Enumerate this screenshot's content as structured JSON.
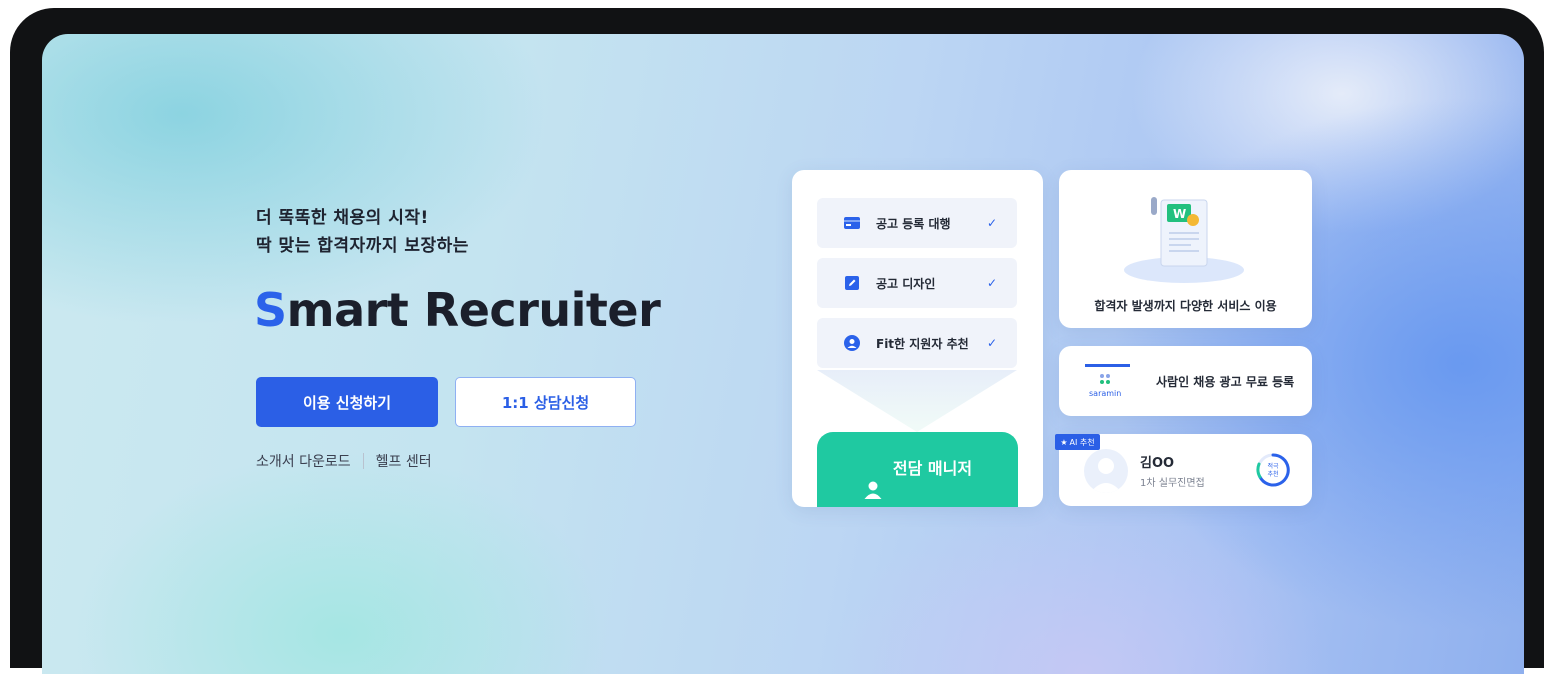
{
  "hero": {
    "tagline_line1": "더 똑똑한 채용의 시작!",
    "tagline_line2": "딱 맞는 합격자까지 보장하는",
    "brand_first_letter": "S",
    "brand_rest": "mart Recruiter",
    "primary_button": "이용 신청하기",
    "secondary_button": "1:1 상담신청",
    "link_download": "소개서 다운로드",
    "link_help": "헬프 센터"
  },
  "services": [
    {
      "label": "공고 등록 대행",
      "icon": "card-icon"
    },
    {
      "label": "공고 디자인",
      "icon": "pencil-icon"
    },
    {
      "label": "Fit한 지원자 추천",
      "icon": "user-icon"
    }
  ],
  "manager": {
    "label": "전담 매니저"
  },
  "doc_card": {
    "caption": "합격자 발생까지 다양한 서비스 이용",
    "doc_letter": "W"
  },
  "saramin_card": {
    "logo_text": "saramin",
    "label": "사람인 채용 광고 무료 등록"
  },
  "profile_card": {
    "badge": "AI 추천",
    "name": "김OO",
    "subtitle": "1차 실무진면접",
    "ring_line1": "적극",
    "ring_line2": "추천"
  },
  "colors": {
    "primary": "#2b5fe6",
    "mint": "#1fc9a1",
    "check": "#2b62ea"
  }
}
